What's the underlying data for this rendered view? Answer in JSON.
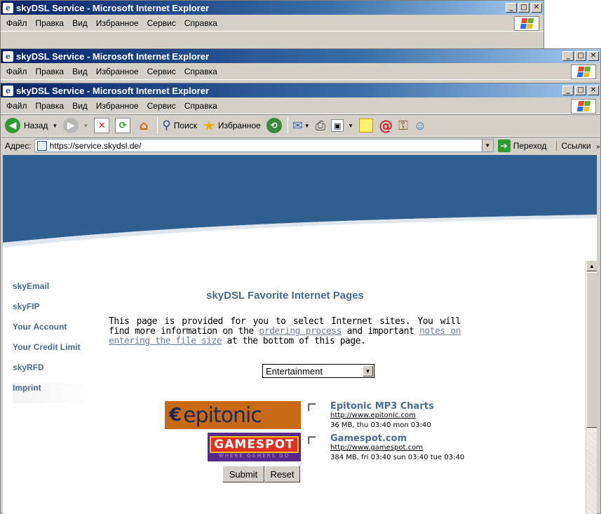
{
  "windows": [
    {
      "title": "skyDSL Service - Microsoft Internet Explorer"
    },
    {
      "title": "skyDSL Service - Microsoft Internet Explorer"
    },
    {
      "title": "skyDSL Service - Microsoft Internet Explorer"
    }
  ],
  "menu": {
    "file": "Файл",
    "edit": "Правка",
    "view": "Вид",
    "favorites": "Избранное",
    "tools": "Сервис",
    "help": "Справка"
  },
  "toolbar": {
    "back": "Назад",
    "search": "Поиск",
    "favorites": "Избранное"
  },
  "address": {
    "label": "Адрес:",
    "url": "https://service.skydsl.de/",
    "go": "Переход",
    "links": "Ссылки"
  },
  "nav": {
    "items": [
      "skyEmail",
      "skyFIP",
      "Your Account",
      "Your Credit Limit",
      "skyRFD",
      "Imprint"
    ]
  },
  "page": {
    "heading": "skyDSL Favorite Internet Pages",
    "intro_1": "This page is provided for you to select Internet sites. You will find more information on the ",
    "link_ordering": "ordering process",
    "intro_2": " and important ",
    "link_notes": "notes on entering the file size",
    "intro_3": " at the bottom of this page.",
    "category": "Entertainment",
    "sites": [
      {
        "name": "Epitonic MP3 Charts",
        "url": "http://www.epitonic.com",
        "info": "36 MB, thu 03:40 mon 03:40",
        "logo_text": "epitonic"
      },
      {
        "name": "Gamespot.com",
        "url": "http://www.gamespot.com",
        "info": "384 MB, fri 03:40 sun 03:40 tue 03:40",
        "logo_text": "GAMESPOT",
        "logo_sub": "WHERE GAMERS GO"
      }
    ],
    "submit": "Submit",
    "reset": "Reset"
  },
  "colors": {
    "banner": "#2e5f8f",
    "nav_text": "#4a6a8a"
  }
}
